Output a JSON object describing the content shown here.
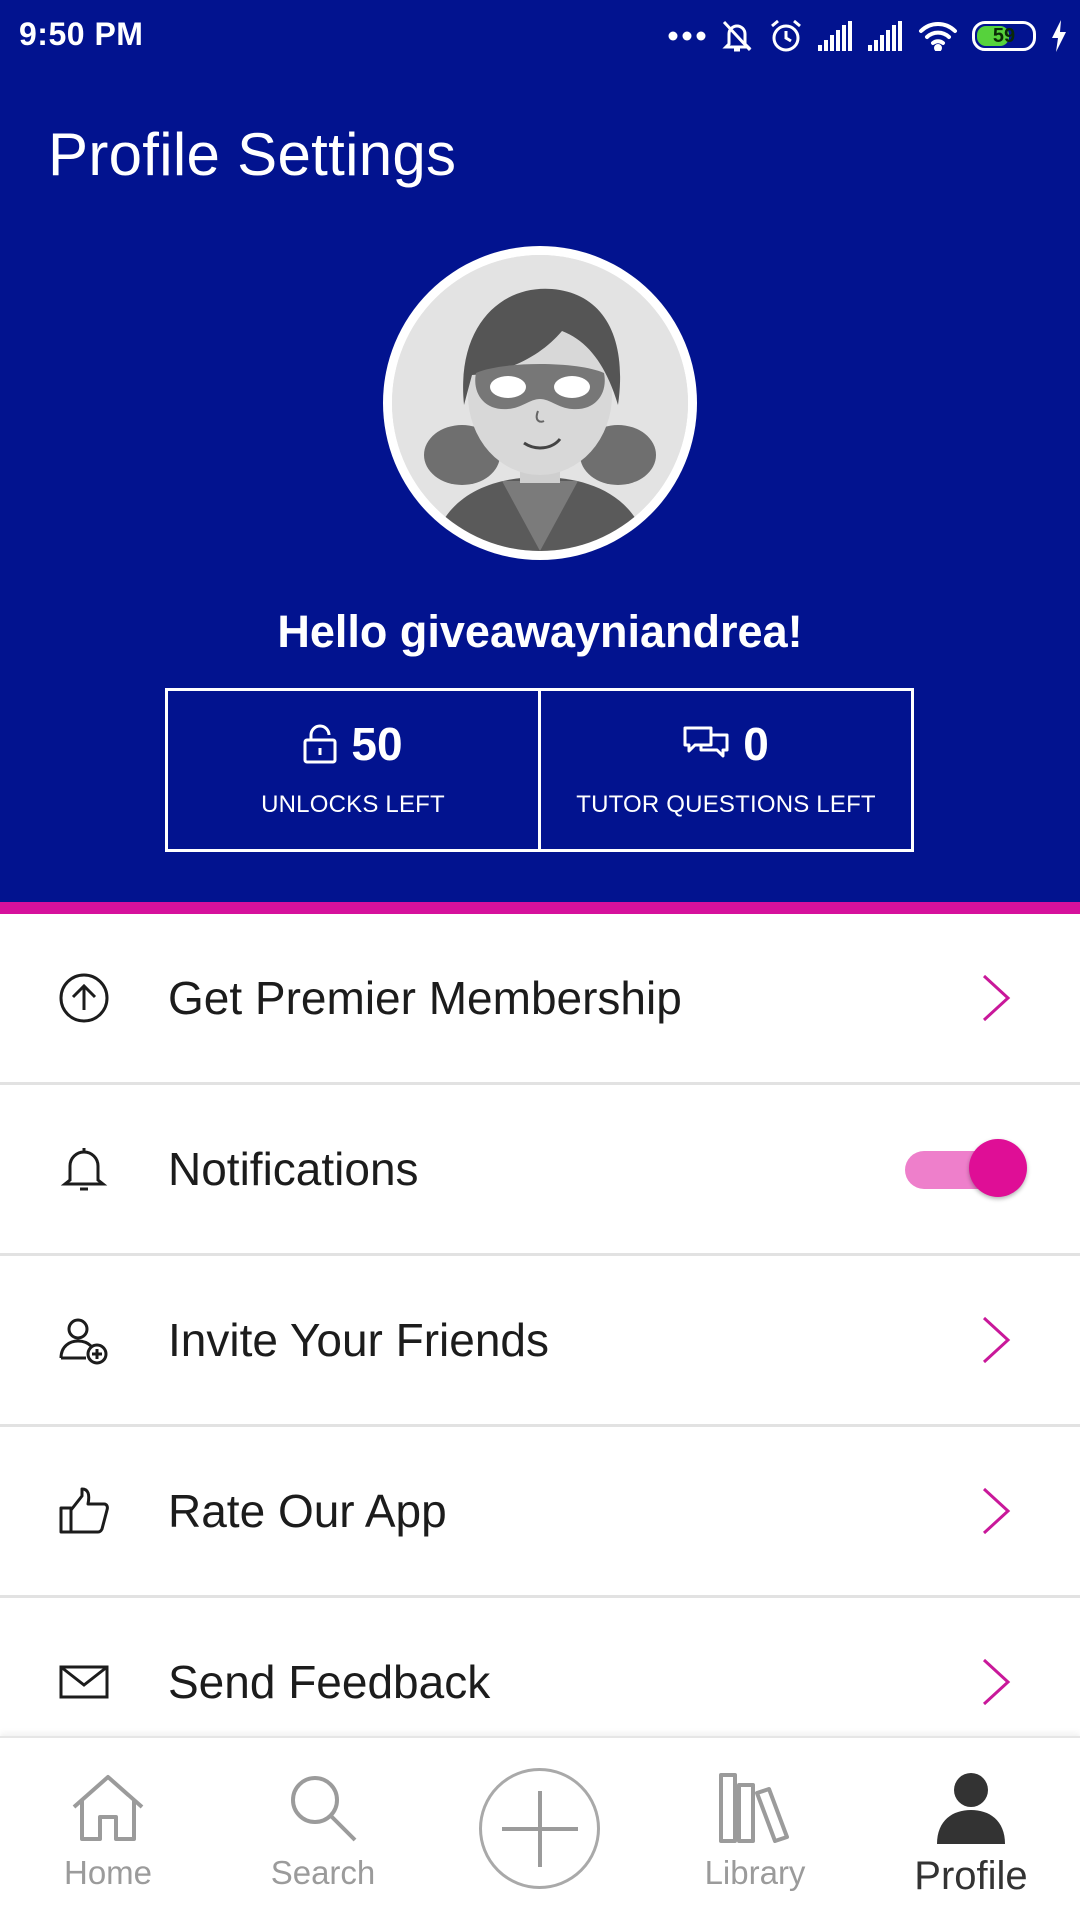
{
  "status_bar": {
    "time": "9:50 PM",
    "battery_level": "59",
    "icons": [
      "more-dots-icon",
      "bell-off-icon",
      "alarm-icon",
      "signal-icon",
      "signal-icon",
      "wifi-icon",
      "battery-icon",
      "charging-icon"
    ]
  },
  "header": {
    "title": "Profile Settings",
    "greeting": "Hello giveawayniandrea!"
  },
  "stats": {
    "unlocks": {
      "value": "50",
      "label": "UNLOCKS LEFT",
      "icon": "lock-icon"
    },
    "tutor": {
      "value": "0",
      "label": "TUTOR QUESTIONS LEFT",
      "icon": "chat-bubbles-icon"
    }
  },
  "menu": {
    "items": [
      {
        "label": "Get Premier Membership",
        "icon": "arrow-up-circle-icon",
        "control": "chevron"
      },
      {
        "label": "Notifications",
        "icon": "bell-icon",
        "control": "toggle",
        "toggle_on": true
      },
      {
        "label": "Invite Your Friends",
        "icon": "add-friend-icon",
        "control": "chevron"
      },
      {
        "label": "Rate Our App",
        "icon": "thumbs-up-icon",
        "control": "chevron"
      },
      {
        "label": "Send Feedback",
        "icon": "envelope-icon",
        "control": "chevron"
      }
    ]
  },
  "bottom_nav": {
    "items": [
      {
        "label": "Home",
        "icon": "home-icon"
      },
      {
        "label": "Search",
        "icon": "search-icon"
      },
      {
        "label": "",
        "icon": "add-icon"
      },
      {
        "label": "Library",
        "icon": "library-icon"
      },
      {
        "label": "Profile",
        "icon": "profile-icon",
        "active": true
      }
    ]
  },
  "colors": {
    "header_bg": "#02138f",
    "accent": "#d6119c",
    "toggle_track": "#ee7fcb",
    "toggle_knob": "#df0e96"
  }
}
